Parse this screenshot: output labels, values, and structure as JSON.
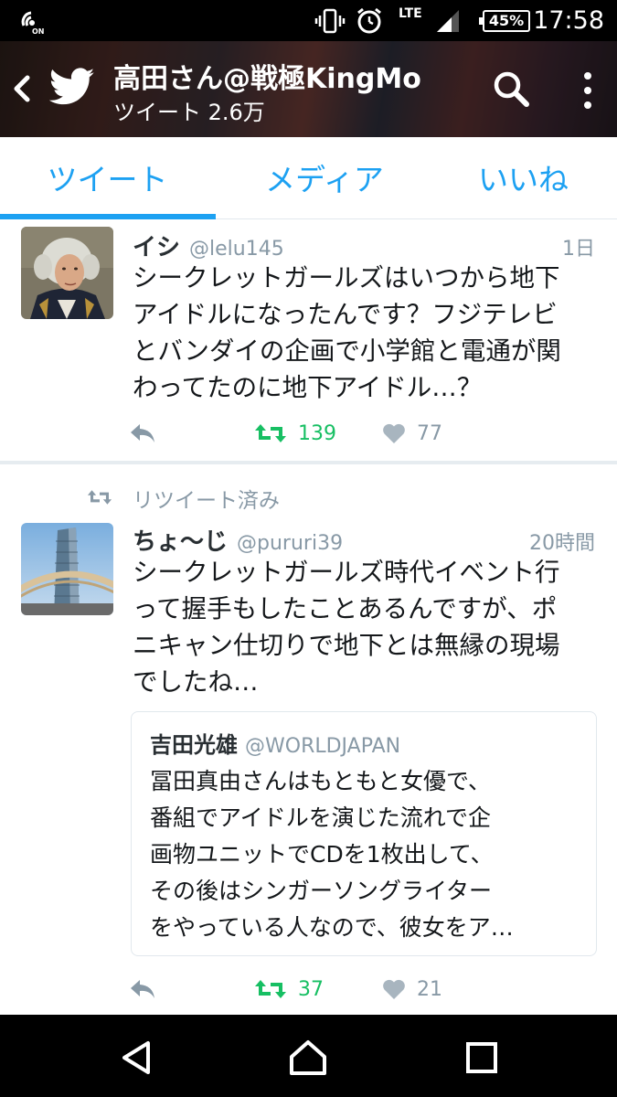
{
  "status_bar": {
    "time": "17:58",
    "battery": "45%",
    "network": "LTE",
    "left_icon": "nfc-on-icon"
  },
  "header": {
    "title": "高田さん@戦極KingMo",
    "subtitle": "ツイート 2.6万"
  },
  "tabs": [
    {
      "label": "ツイート",
      "active": true
    },
    {
      "label": "メディア",
      "active": false
    },
    {
      "label": "いいね",
      "active": false
    }
  ],
  "tweets": [
    {
      "name": "イシ",
      "handle": "@lelu145",
      "time": "1日",
      "text": "シークレットガールズはいつから地下\nアイドルになったんです？フジテレビ\nとバンダイの企画で小学館と電通が関\nわってたのに地下アイドル…？",
      "retweets": "139",
      "likes": "77"
    },
    {
      "retweet_label": "リツイート済み",
      "name": "ちょ〜じ",
      "handle": "@pururi39",
      "time": "20時間",
      "text": "シークレットガールズ時代イベント行\nって握手もしたことあるんですが、ポ\nニキャン仕切りで地下とは無縁の現場\nでしたね…",
      "quote": {
        "name": "吉田光雄",
        "handle": "@WORLDJAPAN",
        "text": "冨田真由さんはもともと女優で、\n番組でアイドルを演じた流れで企\n画物ユニットでCDを1枚出して、\nその後はシンガーソングライター\nをやっている人なので、彼女をア…"
      },
      "retweets": "37",
      "likes": "21"
    }
  ],
  "colors": {
    "accent": "#1da1f2",
    "retweet": "#17bf63",
    "muted": "#8899a6"
  }
}
